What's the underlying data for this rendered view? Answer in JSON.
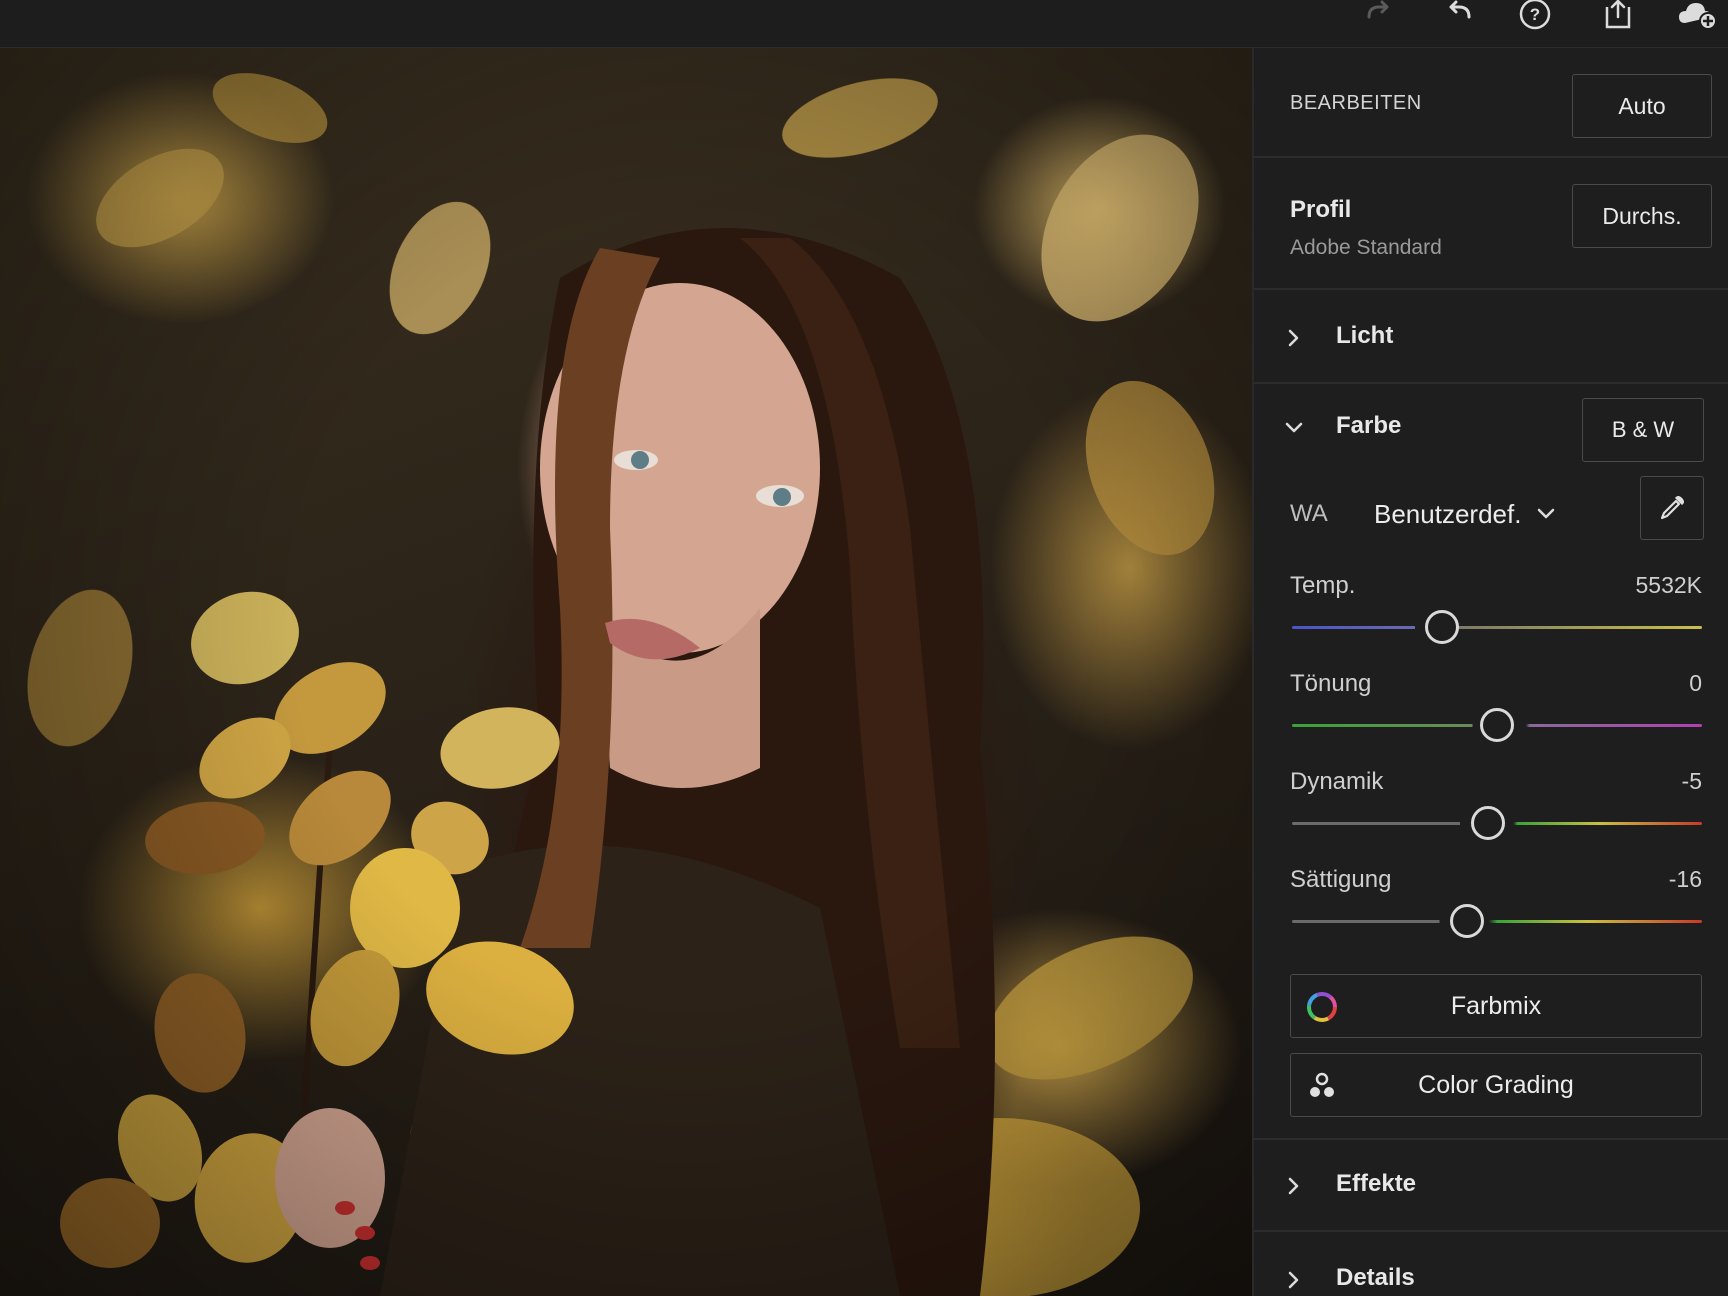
{
  "toolbar": {
    "icons": [
      "redo-icon",
      "undo-icon",
      "help-icon",
      "share-icon",
      "cloud-sync-icon"
    ]
  },
  "photo": {
    "description_icon": "portrait-photo"
  },
  "panel": {
    "header": {
      "title": "BEARBEITEN",
      "auto_label": "Auto"
    },
    "profile": {
      "title": "Profil",
      "value": "Adobe Standard",
      "browse_label": "Durchs."
    },
    "light": {
      "title": "Licht",
      "expanded": false
    },
    "color": {
      "title": "Farbe",
      "expanded": true,
      "bw_label": "B & W",
      "wb": {
        "label": "WA",
        "value": "Benutzerdef."
      },
      "sliders": [
        {
          "label": "Temp.",
          "value": "5532K",
          "position": 0.33
        },
        {
          "label": "Tönung",
          "value": "0",
          "position": 0.5
        },
        {
          "label": "Dynamik",
          "value": "-5",
          "position": 0.475
        },
        {
          "label": "Sättigung",
          "value": "-16",
          "position": 0.42
        }
      ],
      "colormix_label": "Farbmix",
      "grading_label": "Color Grading"
    },
    "effects": {
      "title": "Effekte",
      "expanded": false
    },
    "details": {
      "title": "Details",
      "expanded": false
    }
  },
  "colors": {
    "panel_bg": "#1e1e1e",
    "divider": "#2c2c2c",
    "text": "#e6e6e6",
    "muted": "#9a9a9a"
  }
}
